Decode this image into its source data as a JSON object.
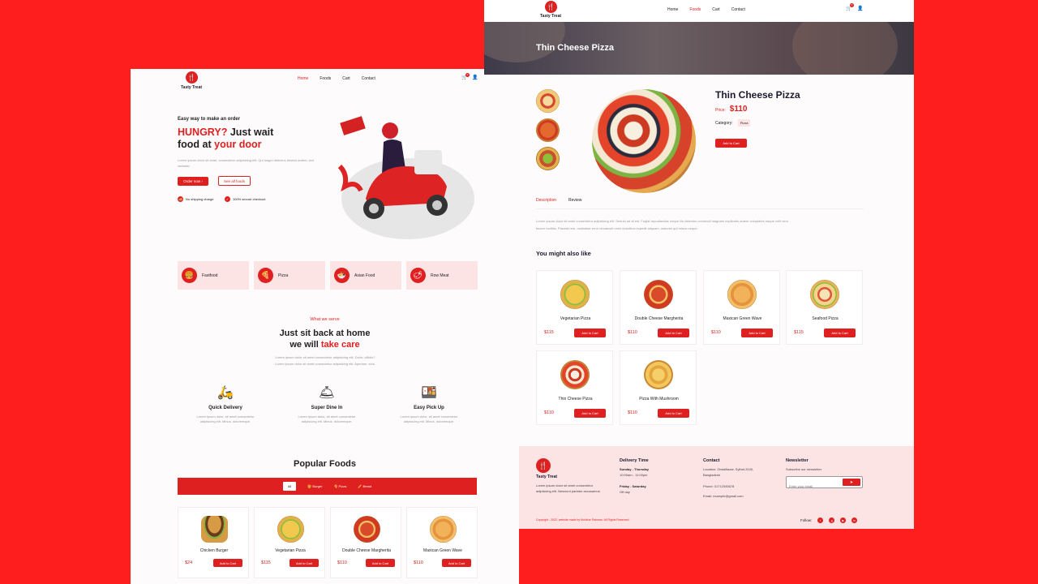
{
  "brand": {
    "name": "Tasty Treat",
    "accent": "#df2020",
    "page_bg": "#ff1e1e",
    "pink": "#fde4e4",
    "icon": "fork-spoon-icon"
  },
  "left": {
    "nav": [
      "Home",
      "Foods",
      "Cart",
      "Contact"
    ],
    "cart_count": "0",
    "hero": {
      "small": "Easy way to make an order",
      "title_red1": "HUNGRY?",
      "title_dark1": " Just wait",
      "title_dark2": "food at ",
      "title_red2": "your door",
      "lorem": "Lorem ipsum dolor sit amet, consectetur adipisicing elit. Qui magni delectus tenetur autem, sint veritatis!",
      "order_btn": "Order now ›",
      "see_btn": "See all foods",
      "feat1": "No shipping charge",
      "feat2": "100% secure checkout"
    },
    "categories": [
      {
        "label": "Fastfood",
        "icon": "burger-icon"
      },
      {
        "label": "Pizza",
        "icon": "pizza-slice-icon"
      },
      {
        "label": "Asian Food",
        "icon": "noodles-icon"
      },
      {
        "label": "Row Meat",
        "icon": "meat-icon"
      }
    ],
    "serve": {
      "sub": "What we serve",
      "title1": "Just sit back at home",
      "title2a": "we will ",
      "title2b": "take care",
      "lorem1": "Lorem ipsum dolor sit amet consectetur adipisicing elit. Dolor, officiis?",
      "lorem2": "Lorem ipsum dolor sit amet consectetur adipisicing elit. Aperiam, eius."
    },
    "services": [
      {
        "title": "Quick Delivery",
        "icon": "scooter-icon",
        "d1": "Lorem ipsum dolor, sit amet consectetur",
        "d2": "adipisicing elit. Minus, doloremque."
      },
      {
        "title": "Super Dine In",
        "icon": "cloche-icon",
        "d1": "Lorem ipsum dolor, sit amet consectetur",
        "d2": "adipisicing elit. Minus, doloremque."
      },
      {
        "title": "Easy Pick Up",
        "icon": "pickup-icon",
        "d1": "Lorem ipsum dolor, sit amet consectetur",
        "d2": "adipisicing elit. Minus, doloremque."
      }
    ],
    "popular": {
      "title": "Popular Foods",
      "filters": [
        "All",
        "Burger",
        "Pizza",
        "Bread"
      ]
    },
    "foods": [
      {
        "name": "Chicken Burger",
        "price": "$24"
      },
      {
        "name": "Vegetarian Pizza",
        "price": "$115"
      },
      {
        "name": "Double Cheese Margherita",
        "price": "$110"
      },
      {
        "name": "Maxican Green Wave",
        "price": "$110"
      }
    ],
    "add_label": "Add to Cart"
  },
  "right": {
    "nav": [
      "Home",
      "Foods",
      "Cart",
      "Contact"
    ],
    "cart_count": "0",
    "banner_title": "Thin Cheese Pizza",
    "product": {
      "title": "Thin Cheese Pizza",
      "price_label": "Price:",
      "price": "$110",
      "cat_label": "Category:",
      "cat": "Pizza",
      "add": "Add to Cart"
    },
    "tabs": [
      "Description",
      "Review"
    ],
    "desc1": "Lorem ipsum dolor sit amet consectetur adipisicing elit. Sedulu ad at est. Fugiat repudiandae neque illo delectus commodi magnam explicabo autem voluptates eaque velit vero",
    "desc2": "facere mollitia. Placeat rem, molestiae error obcaecati enim doloribus impedit aliquam, maiores qui minus neque.",
    "like_title": "You might also like",
    "related": [
      {
        "name": "Vegetarian Pizza",
        "price": "$115"
      },
      {
        "name": "Double Cheese Margherita",
        "price": "$110"
      },
      {
        "name": "Maxican Green Wave",
        "price": "$110"
      },
      {
        "name": "Seafood Pizza",
        "price": "$115"
      },
      {
        "name": "Thin Cheese Pizza",
        "price": "$110"
      },
      {
        "name": "Pizza With Mushroom",
        "price": "$110"
      }
    ],
    "footer": {
      "brand": "Tasty Treat",
      "about1": "Lorem ipsum dolor sit amet consectetur",
      "about2": "adipisicing elit. Nesciunt pariatur accusamus",
      "delivery_h": "Delivery Time",
      "d1": "Sunday - Thursday",
      "d1t": "10:00am - 11:00pm",
      "d2": "Friday - Saturday",
      "d2t": "Off day",
      "contact_h": "Contact",
      "loc1": "Location: ZindaBazar, Sylhet-3100,",
      "loc2": "Bangladesh",
      "phone": "Phone: 01712345678",
      "email": "Email: example@gmail.com",
      "news_h": "Newsletter",
      "news_sub": "Subscribe our newsletter",
      "news_ph": "Enter your email",
      "send": "➤",
      "copy": "Copyright - 2022, website made by Muhibur Rahman. All Rights Reserved.",
      "follow": "Follow:"
    }
  }
}
